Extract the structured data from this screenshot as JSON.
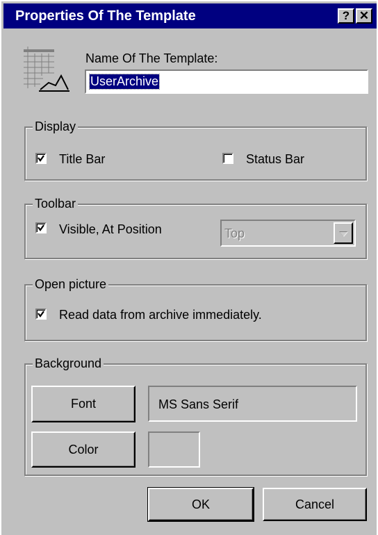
{
  "window": {
    "title": "Properties Of The Template",
    "help_glyph": "?",
    "close_glyph": "✕"
  },
  "template_name": {
    "label": "Name Of The Template:",
    "value": "UserArchive",
    "icon": "table-chart-icon"
  },
  "display": {
    "legend": "Display",
    "title_bar": {
      "label": "Title Bar",
      "checked": true
    },
    "status_bar": {
      "label": "Status Bar",
      "checked": false
    }
  },
  "toolbar": {
    "legend": "Toolbar",
    "visible": {
      "label": "Visible, At Position",
      "checked": true
    },
    "position": {
      "value": "Top",
      "disabled": true
    }
  },
  "open_picture": {
    "legend": "Open picture",
    "read_data": {
      "label": "Read data from archive immediately.",
      "checked": true
    }
  },
  "background": {
    "legend": "Background",
    "font_button": "Font",
    "font_value": "MS Sans Serif",
    "color_button": "Color",
    "color_value": "#c0c0c0"
  },
  "actions": {
    "ok": "OK",
    "cancel": "Cancel"
  },
  "colors": {
    "titlebar": "#000080",
    "face": "#c0c0c0",
    "selection": "#000080"
  }
}
